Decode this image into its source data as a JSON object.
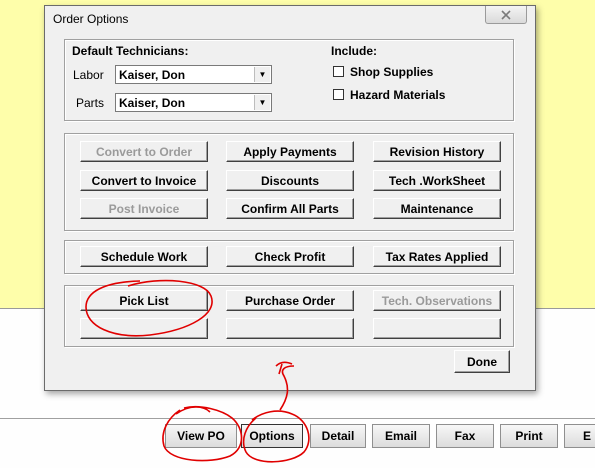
{
  "dialog": {
    "title": "Order Options",
    "technicians": {
      "heading": "Default Technicians:",
      "labor_label": "Labor",
      "labor_value": "Kaiser, Don",
      "parts_label": "Parts",
      "parts_value": "Kaiser, Don"
    },
    "include": {
      "heading": "Include:",
      "shop_supplies": "Shop Supplies",
      "hazard_materials": "Hazard Materials"
    },
    "buttons": {
      "convert_to_order": "Convert to Order",
      "apply_payments": "Apply Payments",
      "revision_history": "Revision History",
      "convert_to_invoice": "Convert to Invoice",
      "discounts": "Discounts",
      "tech_worksheet": "Tech .WorkSheet",
      "post_invoice": "Post Invoice",
      "confirm_all_parts": "Confirm All Parts",
      "maintenance": "Maintenance",
      "schedule_work": "Schedule Work",
      "check_profit": "Check Profit",
      "tax_rates_applied": "Tax Rates Applied",
      "pick_list": "Pick List",
      "purchase_order": "Purchase Order",
      "tech_observations": "Tech. Observations",
      "done": "Done"
    }
  },
  "toolbar": {
    "view_po": "View PO",
    "options": "Options",
    "detail": "Detail",
    "email": "Email",
    "fax": "Fax",
    "print": "Print",
    "partial": "E"
  },
  "colors": {
    "background": "#fefeaa",
    "annotation": "#e00000"
  }
}
